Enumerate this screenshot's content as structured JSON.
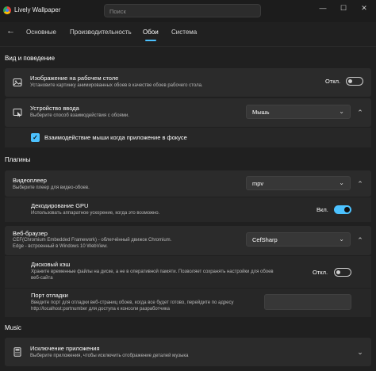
{
  "window": {
    "title": "Lively Wallpaper",
    "search_placeholder": "Поиск"
  },
  "controls": {
    "minimize": "—",
    "maximize": "☐",
    "close": "✕"
  },
  "nav": {
    "back": "←",
    "tabs": [
      {
        "label": "Основные"
      },
      {
        "label": "Производительность"
      },
      {
        "label": "Обои",
        "active": true
      },
      {
        "label": "Система"
      }
    ]
  },
  "sections": {
    "view": "Вид и поведение",
    "plugins": "Плагины",
    "music": "Music"
  },
  "desktop_wallpaper": {
    "title": "Изображение на рабочем столе",
    "desc": "Установите картинку анимированных обоев в качестве обоев рабочего стола.",
    "toggle_label": "Откл.",
    "on": false
  },
  "input_device": {
    "title": "Устройство ввода",
    "desc": "Выберите способ взаимодействия с обоями.",
    "value": "Мышь",
    "checkbox_label": "Взаимодействие мыши когда приложение в фокусе",
    "checked": true
  },
  "video_player": {
    "title": "Видеоплеер",
    "desc": "Выберите плеер для видео-обоев.",
    "value": "mpv"
  },
  "gpu_decoding": {
    "title": "Декодирование GPU",
    "desc": "Использовать аппаратное ускорение, когда это возможно.",
    "toggle_label": "Вкл.",
    "on": true
  },
  "web_browser": {
    "title": "Веб-браузер",
    "desc1": "CEF(Chromium Embedded Framework) - облегчённый движок Chromium.",
    "desc2": "Edge - встроенный в Windows 10 WebView.",
    "value": "CefSharp"
  },
  "disk_cache": {
    "title": "Дисковый кэш",
    "desc1": "Храните временные файлы на диске, а не в оперативной памяти. Позволяет сохранять настройки для обоев",
    "desc2": "веб-сайта",
    "toggle_label": "Откл.",
    "on": false
  },
  "debug_port": {
    "title": "Порт отладки",
    "desc1": "Введите порт для отладки веб-страниц обоев, когда все будет готово, перейдите по адресу",
    "desc2": "http://localhost:portnumber для доступа к консоли разработчика",
    "value": ""
  },
  "app_exclusion": {
    "title": "Исключение приложения",
    "desc": "Выберите приложения, чтобы исключить отображение деталей музыка"
  },
  "icons": {
    "back": "arrow-left-icon",
    "desktop": "image-icon",
    "input": "mouse-pointer-icon",
    "exclusion": "calculator-icon",
    "chevron_down": "chevron-down-icon",
    "chevron_up": "chevron-up-icon"
  },
  "colors": {
    "accent": "#4cc2ff",
    "background": "#202020",
    "card": "#2b2b2b"
  }
}
